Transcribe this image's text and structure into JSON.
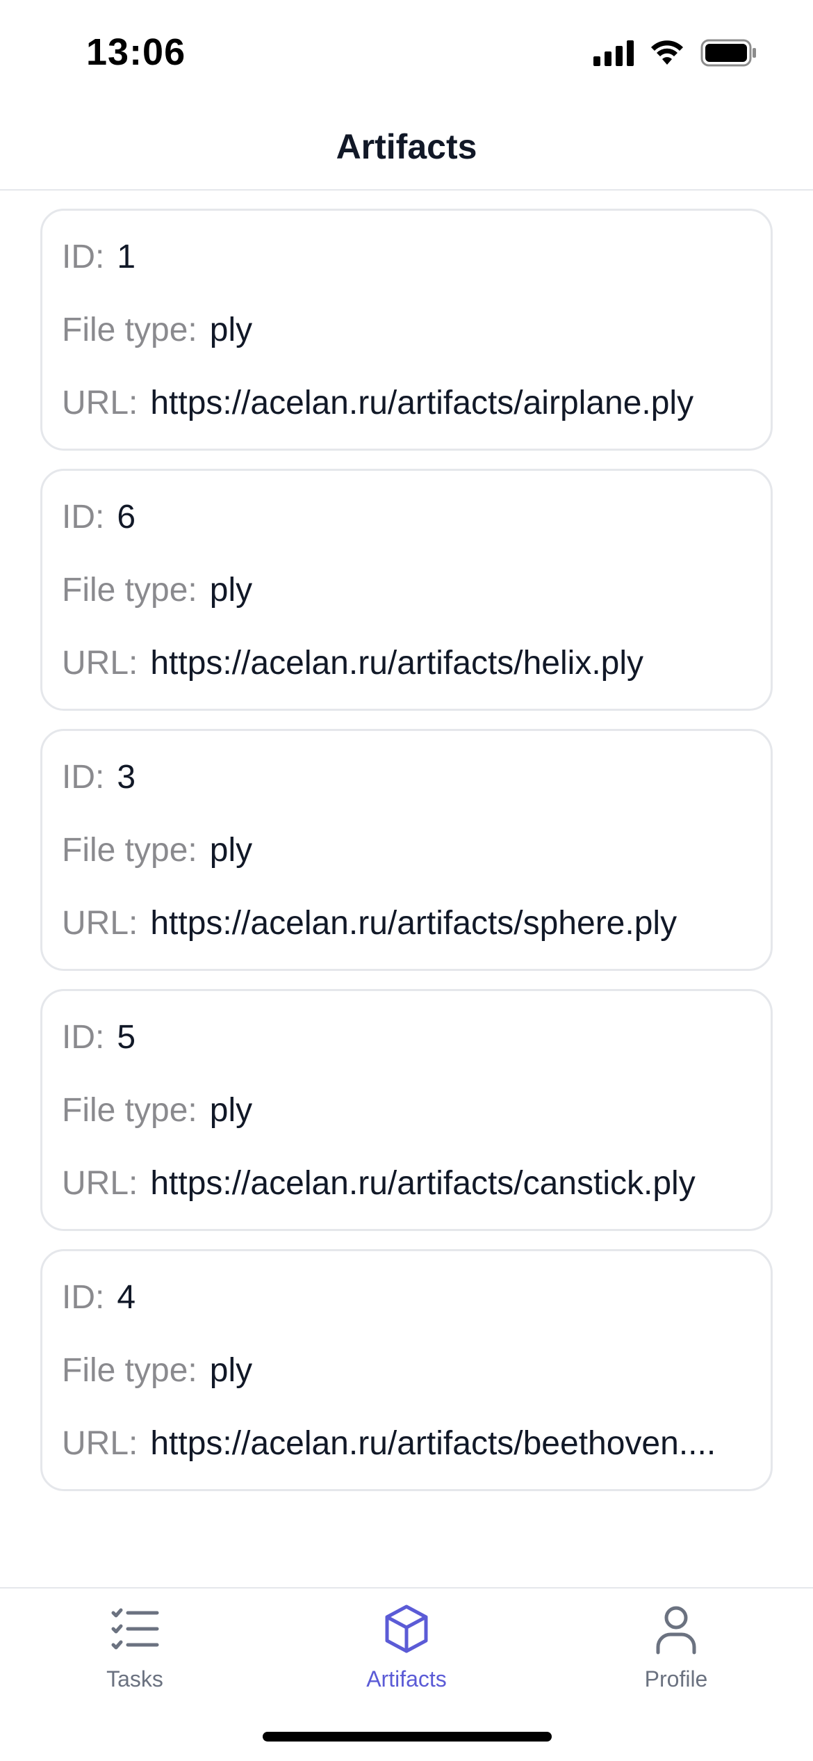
{
  "status_bar": {
    "time": "13:06",
    "icons": [
      "cellular-signal-icon",
      "wifi-icon",
      "battery-icon"
    ]
  },
  "header": {
    "title": "Artifacts"
  },
  "labels": {
    "id": "ID:",
    "file_type": "File type:",
    "url": "URL:"
  },
  "artifacts": [
    {
      "id": "1",
      "file_type": "ply",
      "url": "https://acelan.ru/artifacts/airplane.ply"
    },
    {
      "id": "6",
      "file_type": "ply",
      "url": "https://acelan.ru/artifacts/helix.ply"
    },
    {
      "id": "3",
      "file_type": "ply",
      "url": "https://acelan.ru/artifacts/sphere.ply"
    },
    {
      "id": "5",
      "file_type": "ply",
      "url": "https://acelan.ru/artifacts/canstick.ply"
    },
    {
      "id": "4",
      "file_type": "ply",
      "url": "https://acelan.ru/artifacts/beethoven...."
    }
  ],
  "tab_bar": {
    "tabs": [
      {
        "label": "Tasks",
        "icon": "checklist-icon",
        "active": false
      },
      {
        "label": "Artifacts",
        "icon": "cube-icon",
        "active": true
      },
      {
        "label": "Profile",
        "icon": "person-icon",
        "active": false
      }
    ]
  },
  "colors": {
    "accent": "#5b5bd6",
    "inactive": "#6b7280",
    "label": "#8a8a8e",
    "border": "#e5e7eb"
  }
}
